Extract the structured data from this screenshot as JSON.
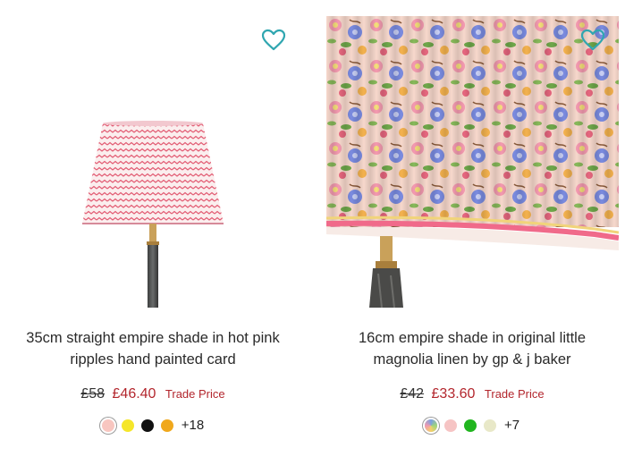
{
  "products": [
    {
      "title_line1": "35cm straight empire shade in hot pink",
      "title_line2": "ripples hand painted card",
      "was_price": "£58",
      "now_price": "£46.40",
      "trade_label": "Trade Price",
      "swatches": [
        "#f8c6c0",
        "#f5e62a",
        "#111111",
        "#f0a81c"
      ],
      "more_count": "+18",
      "wishlist_icon": "heart-outline-icon"
    },
    {
      "title_line1": "16cm empire shade in original little",
      "title_line2": "magnolia linen by gp & j baker",
      "was_price": "£42",
      "now_price": "£33.60",
      "trade_label": "Trade Price",
      "swatches": [
        "multicolor",
        "#f6c4c4",
        "#21b51f",
        "#e8e8c8"
      ],
      "more_count": "+7",
      "wishlist_icon": "heart-outline-icon"
    }
  ],
  "colors": {
    "price_red": "#b3262d",
    "heart_teal": "#2fa6b0"
  }
}
